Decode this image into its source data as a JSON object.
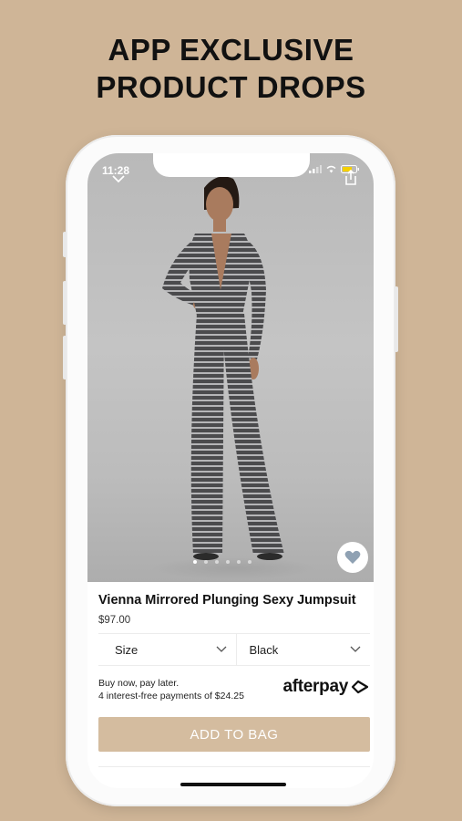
{
  "promo": {
    "line1": "APP EXCLUSIVE",
    "line2": "PRODUCT DROPS"
  },
  "status_bar": {
    "time": "11:28"
  },
  "product": {
    "name": "Vienna Mirrored Plunging Sexy Jumpsuit",
    "price": "$97.00",
    "image_count": 6,
    "active_image": 1
  },
  "selectors": {
    "size_label": "Size",
    "color_value": "Black"
  },
  "afterpay": {
    "line1": "Buy now, pay later.",
    "line2": "4 interest-free payments of $24.25",
    "logo_text": "afterpay"
  },
  "actions": {
    "add_to_bag": "ADD TO BAG"
  },
  "icons": {
    "back": "chevron-down-icon",
    "share": "share-icon",
    "favorite": "heart-icon"
  },
  "colors": {
    "background": "#cfb597",
    "button": "#d4bc9f",
    "heart": "#8fa1b3"
  }
}
